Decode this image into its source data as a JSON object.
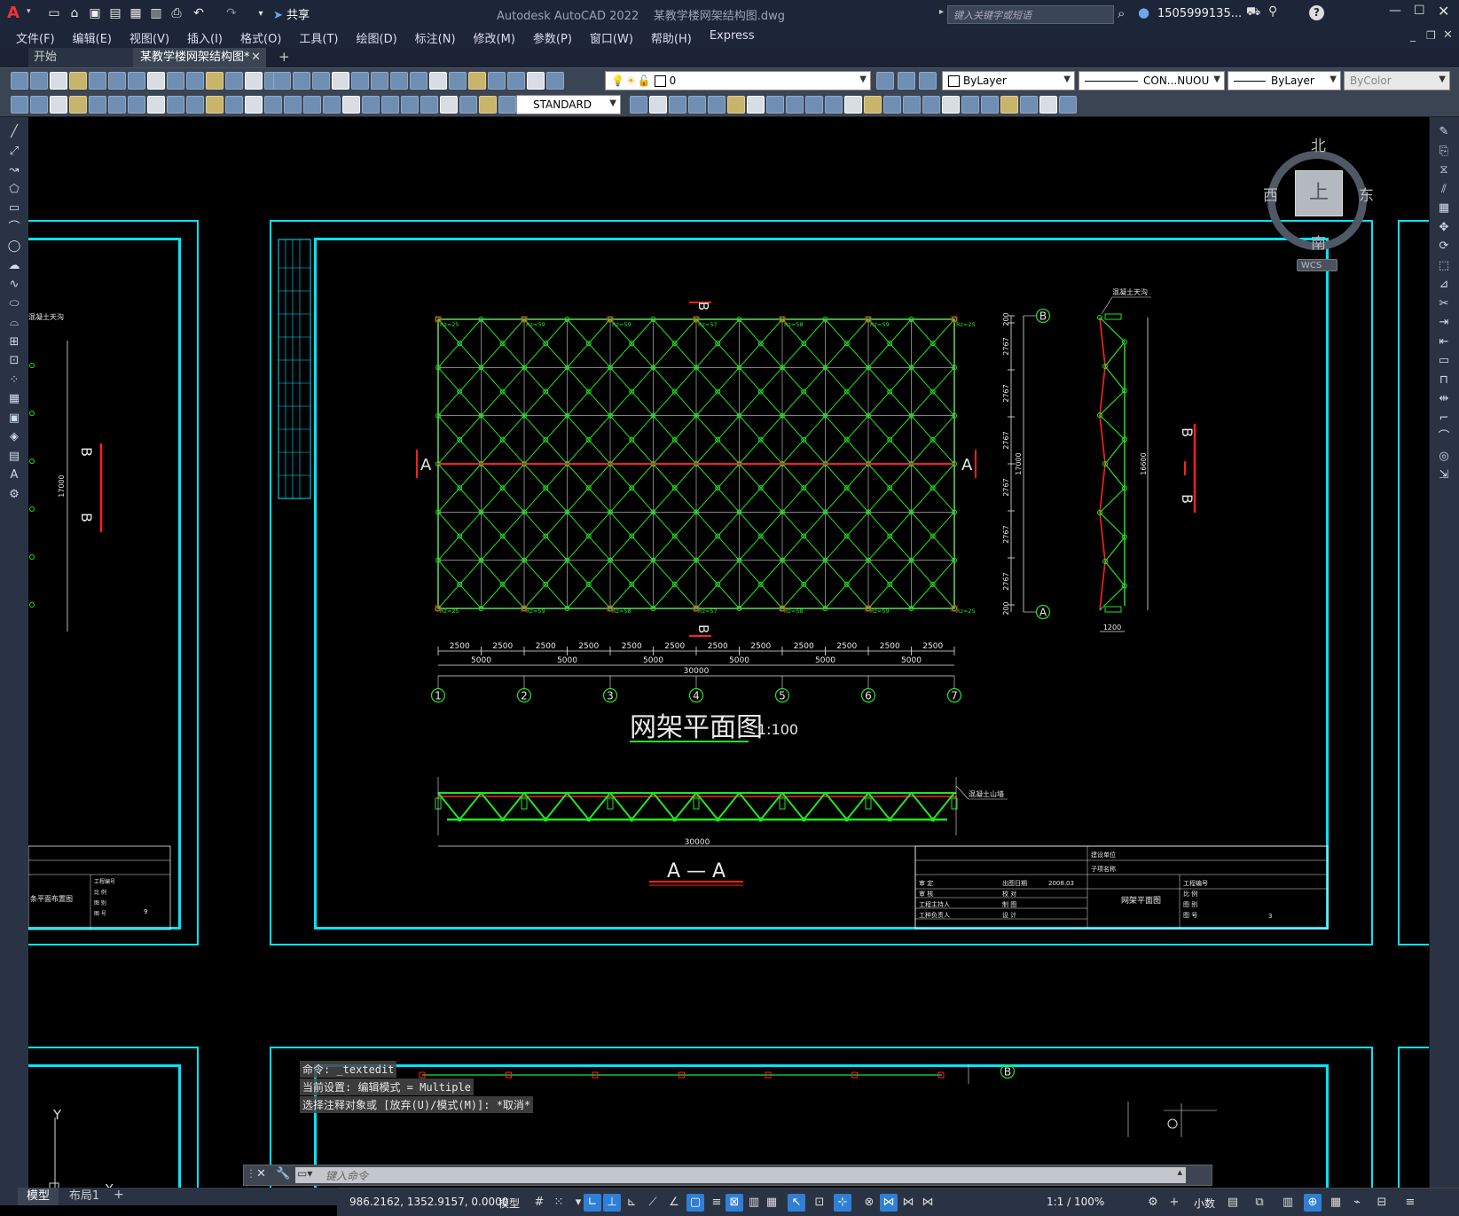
{
  "app": {
    "title": "Autodesk AutoCAD 2022",
    "filename": "某教学楼网架结构图.dwg",
    "share_label": "共享",
    "search_placeholder": "键入关键字或短语",
    "user": "1505999135...",
    "logo_letter": "A"
  },
  "menu": [
    "文件(F)",
    "编辑(E)",
    "视图(V)",
    "插入(I)",
    "格式(O)",
    "工具(T)",
    "绘图(D)",
    "标注(N)",
    "修改(M)",
    "参数(P)",
    "窗口(W)",
    "帮助(H)",
    "Express"
  ],
  "tabs": [
    {
      "label": "开始"
    },
    {
      "label": "某教学楼网架结构图*"
    }
  ],
  "toolbar": {
    "layer_value": "0",
    "color_value": "ByLayer",
    "linetype_value": "CON...NUOU",
    "lineweight_value": "ByLayer",
    "plotstyle_value": "ByColor",
    "textstyle_value": "STANDARD"
  },
  "viewcube": {
    "north": "北",
    "south": "南",
    "east": "东",
    "west": "西",
    "top": "上",
    "wcs": "WCS"
  },
  "drawing": {
    "plan_title": "网架平面图",
    "plan_scale": "1:100",
    "section_title": "A — A",
    "section_total": "30000",
    "overall_width": "30000",
    "spans_2500": [
      "2500",
      "2500",
      "2500",
      "2500",
      "2500",
      "2500",
      "2500",
      "2500",
      "2500",
      "2500",
      "2500",
      "2500"
    ],
    "spans_5000": [
      "5000",
      "5000",
      "5000",
      "5000",
      "5000",
      "5000"
    ],
    "axes_numbers": [
      "1",
      "2",
      "3",
      "4",
      "5",
      "6",
      "7"
    ],
    "axes_letters": [
      "B",
      "A"
    ],
    "vertical_dims": [
      "200",
      "2767",
      "2767",
      "2767",
      "2767",
      "2767",
      "2767",
      "200"
    ],
    "vertical_total": "17000",
    "side_total": "16600",
    "side_base": "1200",
    "section_marker": "A",
    "cut_marker": "B",
    "concrete_wall": "混凝土山墙",
    "concrete_wall_top": "混凝土天沟",
    "left_dim": "17000",
    "support_labels_top": [
      "Rz=25",
      "Rz=59",
      "Rz=59",
      "Rz=57",
      "Rz=58",
      "Rz=59",
      "Rz=25"
    ],
    "support_labels_bottom": [
      "Rz=25",
      "Rz=59",
      "Rz=58",
      "Rz=57",
      "Rz=58",
      "Rz=59",
      "Rz=25"
    ],
    "titleblock": {
      "builder": "建设单位",
      "subproject": "子项名称",
      "drawing_name": "网架平面图",
      "date_label": "出图日期",
      "date_value": "2008.03",
      "project_no": "工程编号",
      "scale": "比 例",
      "drawing": "图 别",
      "number": "图 号",
      "number_value": "3",
      "approve": "审 定",
      "review": "审 核",
      "project_lead": "工程主持人",
      "pro_lead": "工种负责人",
      "check": "校 对",
      "draw": "制 图",
      "design": "设 计"
    },
    "left_titleblock": {
      "name": "条平面布置图",
      "number_value": "9"
    }
  },
  "command": {
    "history": [
      "命令: _textedit",
      "当前设置: 编辑模式 = Multiple",
      "选择注释对象或 [放弃(U)/模式(M)]: *取消*"
    ],
    "prompt_placeholder": "键入命令"
  },
  "layout_tabs": [
    "模型",
    "布局1"
  ],
  "status": {
    "coords": "986.2162, 1352.9157, 0.0000",
    "mode": "模型",
    "scale": "1:1 / 100%",
    "units": "小数"
  },
  "ucs": {
    "y": "Y",
    "x": "X"
  }
}
